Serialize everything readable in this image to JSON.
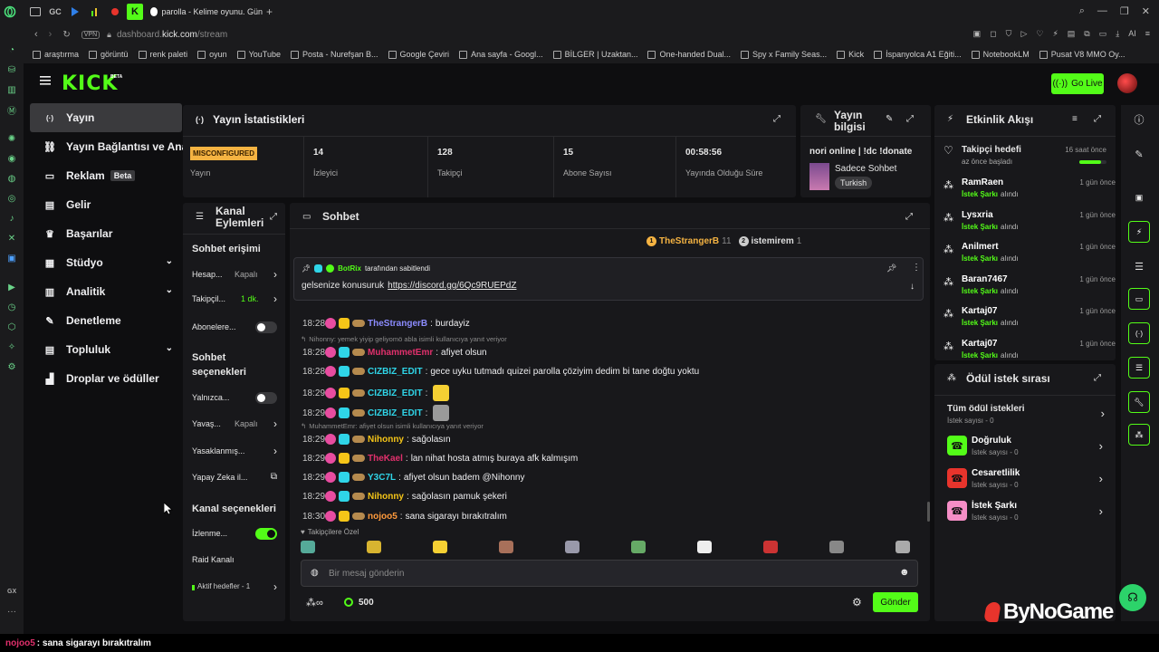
{
  "browser": {
    "tab_title": "parolla - Kelime oyunu. Gün",
    "tab_icons": [
      "GC"
    ],
    "url_prefix": "dashboard.",
    "url_domain": "kick.com",
    "url_path": "/stream",
    "vpn": "VPN",
    "ai": "AI",
    "bookmarks": [
      "araştırma",
      "görüntü",
      "renk paleti",
      "oyun",
      "YouTube",
      "Posta - Nurefşan B...",
      "Google Çeviri",
      "Ana sayfa - Googl...",
      "BİLGER | Uzaktan...",
      "One-handed Dual...",
      "Spy x Family Seas...",
      "Kick",
      "İspanyolca A1 Eğiti...",
      "NotebookLM",
      "Pusat V8 MMO Oy..."
    ],
    "sidebar_bottom_label": "GX"
  },
  "kick": {
    "logo": "KICK",
    "logo_sup": "BETA",
    "go_live": "Go Live",
    "nav": [
      {
        "label": "Yayın",
        "icon": "broadcast-icon"
      },
      {
        "label": "Yayın Bağlantısı ve Anahtarı",
        "icon": "link-icon"
      },
      {
        "label": "Reklam",
        "icon": "ad-icon",
        "badge": "Beta"
      },
      {
        "label": "Gelir",
        "icon": "revenue-icon"
      },
      {
        "label": "Başarılar",
        "icon": "trophy-icon"
      },
      {
        "label": "Stüdyo",
        "icon": "studio-icon"
      },
      {
        "label": "Analitik",
        "icon": "analytics-icon"
      },
      {
        "label": "Denetleme",
        "icon": "moderation-icon"
      },
      {
        "label": "Topluluk",
        "icon": "community-icon"
      },
      {
        "label": "Droplar ve ödüller",
        "icon": "drops-icon"
      }
    ]
  },
  "stats": {
    "title": "Yayın İstatistikleri",
    "badge": "MISCONFIGURED",
    "items": [
      {
        "value": "",
        "label": "Yayın"
      },
      {
        "value": "14",
        "label": "İzleyici"
      },
      {
        "value": "128",
        "label": "Takipçi"
      },
      {
        "value": "15",
        "label": "Abone Sayısı"
      },
      {
        "value": "00:58:56",
        "label": "Yayında Olduğu Süre"
      }
    ]
  },
  "stream_info": {
    "title_line1": "Yayın",
    "title_line2": "bilgisi",
    "stream_title": "nori online | !dc !donate",
    "category": "Sadece Sohbet",
    "tag": "Turkish"
  },
  "channel_actions": {
    "title_line1": "Kanal",
    "title_line2": "Eylemleri",
    "chat_access": "Sohbet erişimi",
    "items1": [
      {
        "label": "Hesap...",
        "value": "Kapalı",
        "type": "arrow"
      },
      {
        "label": "Takipçil...",
        "value": "1 dk.",
        "type": "arrow"
      },
      {
        "label": "Abonelere...",
        "value": "",
        "type": "toggle-off"
      }
    ],
    "chat_options_line1": "Sohbet",
    "chat_options_line2": "seçenekleri",
    "items2": [
      {
        "label": "Yalnızca...",
        "value": "",
        "type": "toggle-off"
      },
      {
        "label": "Yavaş...",
        "value": "Kapalı",
        "type": "arrow"
      },
      {
        "label": "Yasaklanmış...",
        "value": "",
        "type": "arrow"
      },
      {
        "label": "Yapay Zeka il...",
        "value": "",
        "type": "external"
      }
    ],
    "channel_options": "Kanal seçenekleri",
    "items3": [
      {
        "label": "İzlenme...",
        "value": "",
        "type": "toggle-on"
      },
      {
        "label": "Raid Kanalı",
        "value": "",
        "type": "none"
      },
      {
        "label": "Aktif hedefler - 1",
        "value": "",
        "type": "arrow"
      }
    ]
  },
  "chat": {
    "title": "Sohbet",
    "top_gifters": [
      {
        "rank": "1",
        "name": "TheStrangerB",
        "count": "11"
      },
      {
        "rank": "2",
        "name": "istemirem",
        "count": "1"
      }
    ],
    "pinned_by": "BotRix",
    "pinned_suffix": "tarafından sabitlendi",
    "pinned_text": "gelsenize konusuruk",
    "pinned_link": "https://discord.gg/6Qc9RUEPdZ",
    "messages": [
      {
        "time": "18:28",
        "user": "TheStrangerB",
        "color": "#8c8cff",
        "text": "burdayiz",
        "reply": ""
      },
      {
        "time": "18:28",
        "user": "MuhammetEmr",
        "color": "#e1306c",
        "text": "afiyet olsun",
        "reply": "Nihonny: yemek yiyip geliyomö abla isimli kullanıcıya yanıt veriyor"
      },
      {
        "time": "18:28",
        "user": "CIZBIZ_EDIT",
        "color": "#2fd5e8",
        "text": "gece uyku tutmadı quizei parolla çöziyim dedim bi tane doğtu yoktu",
        "reply": ""
      },
      {
        "time": "18:29",
        "user": "CIZBIZ_EDIT",
        "color": "#2fd5e8",
        "text": "",
        "reply": ""
      },
      {
        "time": "18:29",
        "user": "CIZBIZ_EDIT",
        "color": "#2fd5e8",
        "text": "",
        "reply": ""
      },
      {
        "time": "18:29",
        "user": "Nihonny",
        "color": "#f5c518",
        "text": "sağolasın",
        "reply": "MuhammetEmr: afiyet olsun isimli kullanıcıya yanıt veriyor"
      },
      {
        "time": "18:29",
        "user": "TheKael",
        "color": "#e1306c",
        "text": "lan nihat hosta atmış buraya afk kalmışım",
        "reply": ""
      },
      {
        "time": "18:29",
        "user": "Y3C7L",
        "color": "#2fd5e8",
        "text": "afiyet olsun badem @Nihonny",
        "reply": ""
      },
      {
        "time": "18:29",
        "user": "Nihonny",
        "color": "#f5c518",
        "text": "sağolasın pamuk şekeri",
        "reply": ""
      },
      {
        "time": "18:30",
        "user": "nojoo5",
        "color": "#ff9a3c",
        "text": "sana sigarayı bırakıtralım",
        "reply": ""
      }
    ],
    "followers_only": "Takipçilere Özel",
    "input_placeholder": "Bir mesaj gönderin",
    "points": "500",
    "send": "Gönder"
  },
  "activity": {
    "title": "Etkinlik Akışı",
    "goal_title": "Takipçi hedefi",
    "goal_sub": "az önce başladı",
    "goal_time": "16 saat önce",
    "goal_progress": 0.8,
    "reward_label": "İstek Şarkı",
    "reward_suffix": "alındı",
    "items": [
      {
        "user": "RamRaen",
        "time": "1 gün önce"
      },
      {
        "user": "Lysxria",
        "time": "1 gün önce"
      },
      {
        "user": "Anilmert",
        "time": "1 gün önce"
      },
      {
        "user": "Baran7467",
        "time": "1 gün önce"
      },
      {
        "user": "Kartaj07",
        "time": "1 gün önce"
      },
      {
        "user": "Kartaj07",
        "time": "1 gün önce"
      }
    ]
  },
  "rewards": {
    "title": "Ödül istek sırası",
    "all_title": "Tüm ödül istekleri",
    "all_sub": "İstek sayısı - 0",
    "items": [
      {
        "title": "Doğruluk",
        "sub": "İstek sayısı - 0",
        "color": "#53fc18"
      },
      {
        "title": "Cesaretlilik",
        "sub": "İstek sayısı - 0",
        "color": "#e8342c"
      },
      {
        "title": "İstek Şarkı",
        "sub": "İstek sayısı - 0",
        "color": "#f58ec6"
      }
    ]
  },
  "watermark": "ByNoGame",
  "caption": {
    "user": "nojoo5",
    "text": ": sana sigarayı bırakıtralım"
  }
}
